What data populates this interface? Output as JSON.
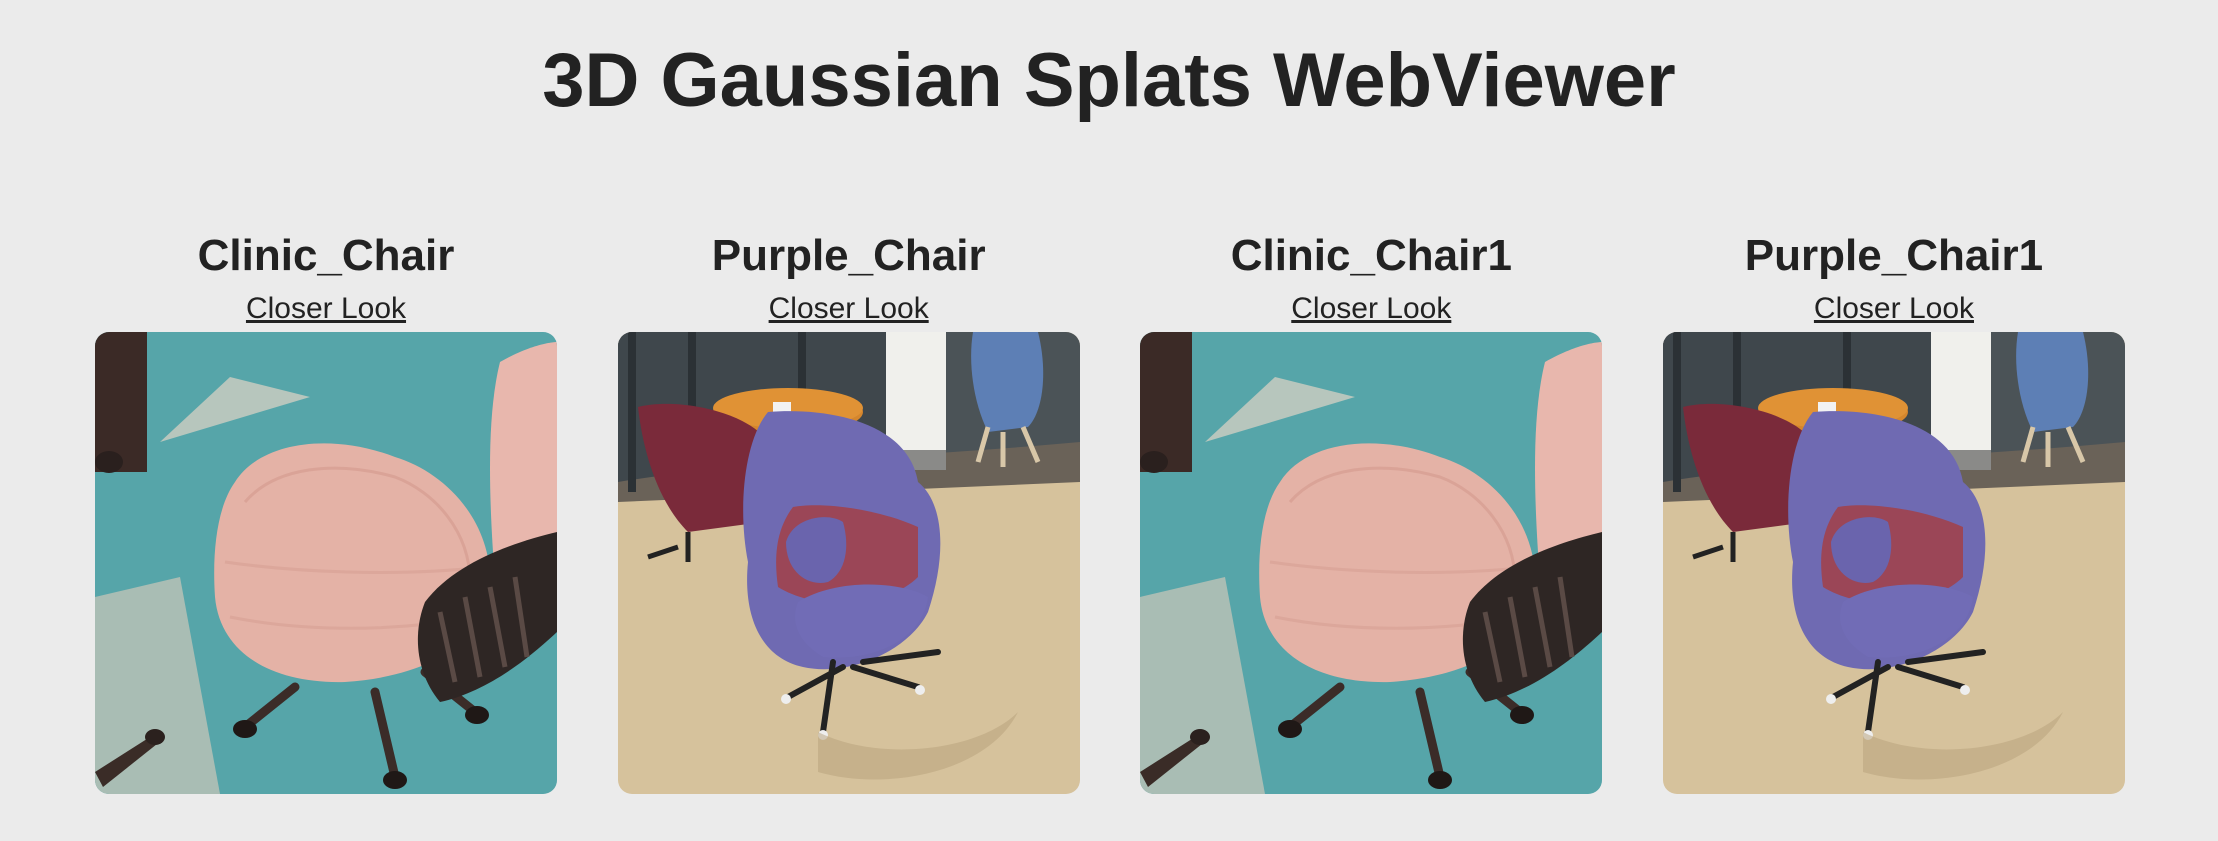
{
  "header": {
    "title": "3D Gaussian Splats WebViewer"
  },
  "models": [
    {
      "name": "Clinic_Chair",
      "link_label": "Closer Look",
      "scene": "clinic-chair"
    },
    {
      "name": "Purple_Chair",
      "link_label": "Closer Look",
      "scene": "purple-chair"
    },
    {
      "name": "Clinic_Chair1",
      "link_label": "Closer Look",
      "scene": "clinic-chair"
    },
    {
      "name": "Purple_Chair1",
      "link_label": "Closer Look",
      "scene": "purple-chair"
    }
  ],
  "colors": {
    "page_background": "#ebebeb",
    "text": "#222222",
    "teal_carpet": "#5aa9ac",
    "pink_fabric": "#e4b2a6",
    "purple_fabric": "#6f6ab2",
    "maroon_fabric": "#7a2a3a",
    "wood_floor": "#d6c29c",
    "orange_table": "#d5862d"
  }
}
